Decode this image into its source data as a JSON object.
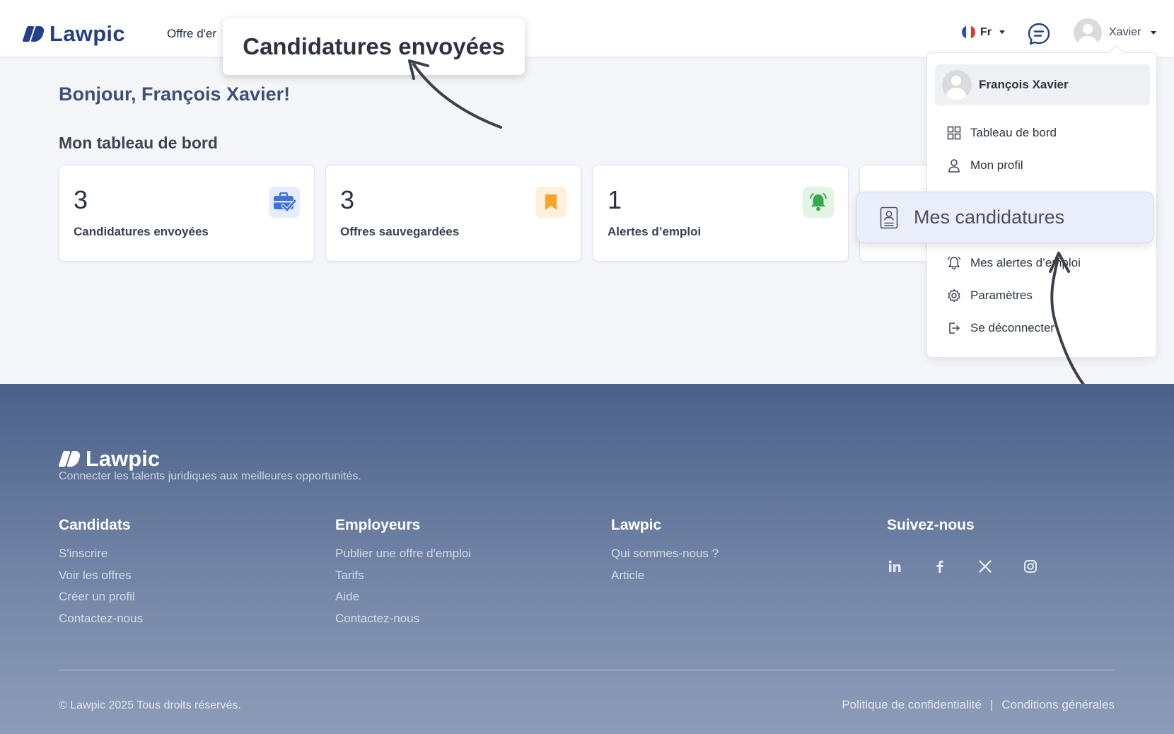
{
  "header": {
    "logo_text": "Lawpic",
    "nav_offer": "Offre d'er",
    "language": "Fr",
    "user_name": "Xavier"
  },
  "callout": {
    "text": "Candidatures envoyées"
  },
  "main": {
    "greeting": "Bonjour, François Xavier!",
    "dashboard_title": "Mon tableau de bord",
    "cards": [
      {
        "value": "3",
        "label": "Candidatures envoyées",
        "icon": "briefcase-check-icon",
        "color": "#3f72e0"
      },
      {
        "value": "3",
        "label": "Offres sauvegardées",
        "icon": "bookmark-icon",
        "color": "#f5a623"
      },
      {
        "value": "1",
        "label": "Alertes d’emploi",
        "icon": "bell-icon",
        "color": "#3aa74b"
      }
    ]
  },
  "dropdown": {
    "full_name": "François Xavier",
    "items": [
      {
        "label": "Tableau de bord",
        "icon": "dashboard-grid-icon"
      },
      {
        "label": "Mon profil",
        "icon": "user-icon"
      },
      {
        "label": "Mes candidatures",
        "icon": "contact-card-icon"
      },
      {
        "label": "Mes alertes d’emploi",
        "icon": "bell-outline-icon"
      },
      {
        "label": "Paramètres",
        "icon": "gear-icon"
      },
      {
        "label": "Se déconnecter",
        "icon": "logout-icon"
      }
    ]
  },
  "footer": {
    "logo_text": "Lawpic",
    "tagline": "Connecter les talents juridiques aux meilleures opportunités.",
    "columns": [
      {
        "title": "Candidats",
        "links": [
          "S'inscrire",
          "Voir les offres",
          "Créer un profil",
          "Contactez-nous"
        ]
      },
      {
        "title": "Employeurs",
        "links": [
          "Publier une offre d'emploi",
          "Tarifs",
          "Aide",
          "Contactez-nous"
        ]
      },
      {
        "title": "Lawpic",
        "links": [
          "Qui sommes-nous ?",
          "Article"
        ]
      },
      {
        "title": "Suivez-nous",
        "links": []
      }
    ],
    "social": [
      "linkedin-icon",
      "facebook-icon",
      "x-icon",
      "instagram-icon"
    ],
    "copyright": "© Lawpic 2025 Tous droits réservés.",
    "privacy": "Politique de confidentialité",
    "separator": "|",
    "terms": "Conditions générales"
  }
}
